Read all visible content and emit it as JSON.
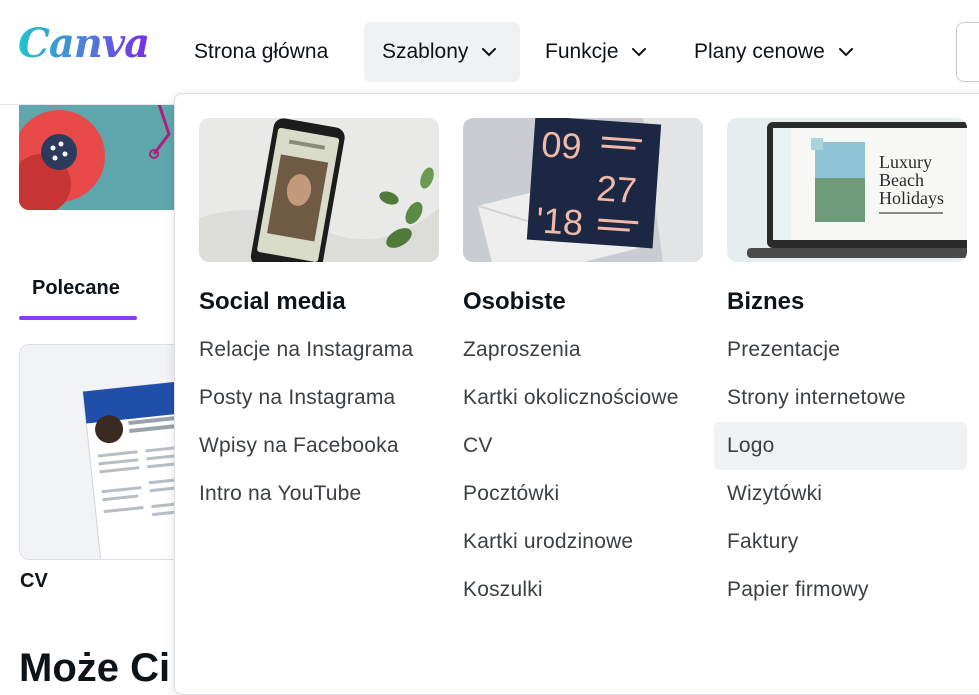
{
  "brand": {
    "logo_text": "Canva"
  },
  "nav": {
    "items": [
      {
        "label": "Strona główna",
        "has_chevron": false
      },
      {
        "label": "Szablony",
        "has_chevron": true,
        "active": true
      },
      {
        "label": "Funkcje",
        "has_chevron": true
      },
      {
        "label": "Plany cenowe",
        "has_chevron": true
      }
    ]
  },
  "page": {
    "tabs": [
      {
        "label": "Polecane",
        "active": true
      }
    ],
    "card_label": "CV",
    "section_heading": "Może Ci się spodobać"
  },
  "dropdown": {
    "columns": [
      {
        "title": "Social media",
        "thumbnail": "instagram-phone-mockup",
        "links": [
          "Relacje na Instagrama",
          "Posty na Instagrama",
          "Wpisy na Facebooka",
          "Intro na YouTube"
        ]
      },
      {
        "title": "Osobiste",
        "thumbnail": "wedding-invitation-card",
        "thumbnail_text": [
          "09",
          "27",
          "'18"
        ],
        "links": [
          "Zaproszenia",
          "Kartki okolicznościowe",
          "CV",
          "Pocztówki",
          "Kartki urodzinowe",
          "Koszulki"
        ]
      },
      {
        "title": "Biznes",
        "thumbnail": "laptop-presentation",
        "thumbnail_text": [
          "Luxury",
          "Beach",
          "Holidays"
        ],
        "links": [
          "Prezentacje",
          "Strony internetowe",
          "Logo",
          "Wizytówki",
          "Faktury",
          "Papier firmowy"
        ],
        "hovered_index": 2
      }
    ]
  },
  "colors": {
    "accent": "#8b3dff",
    "text": "#0e1318",
    "muted_text": "#3c4043",
    "hover_bg": "#f0f1f3"
  }
}
